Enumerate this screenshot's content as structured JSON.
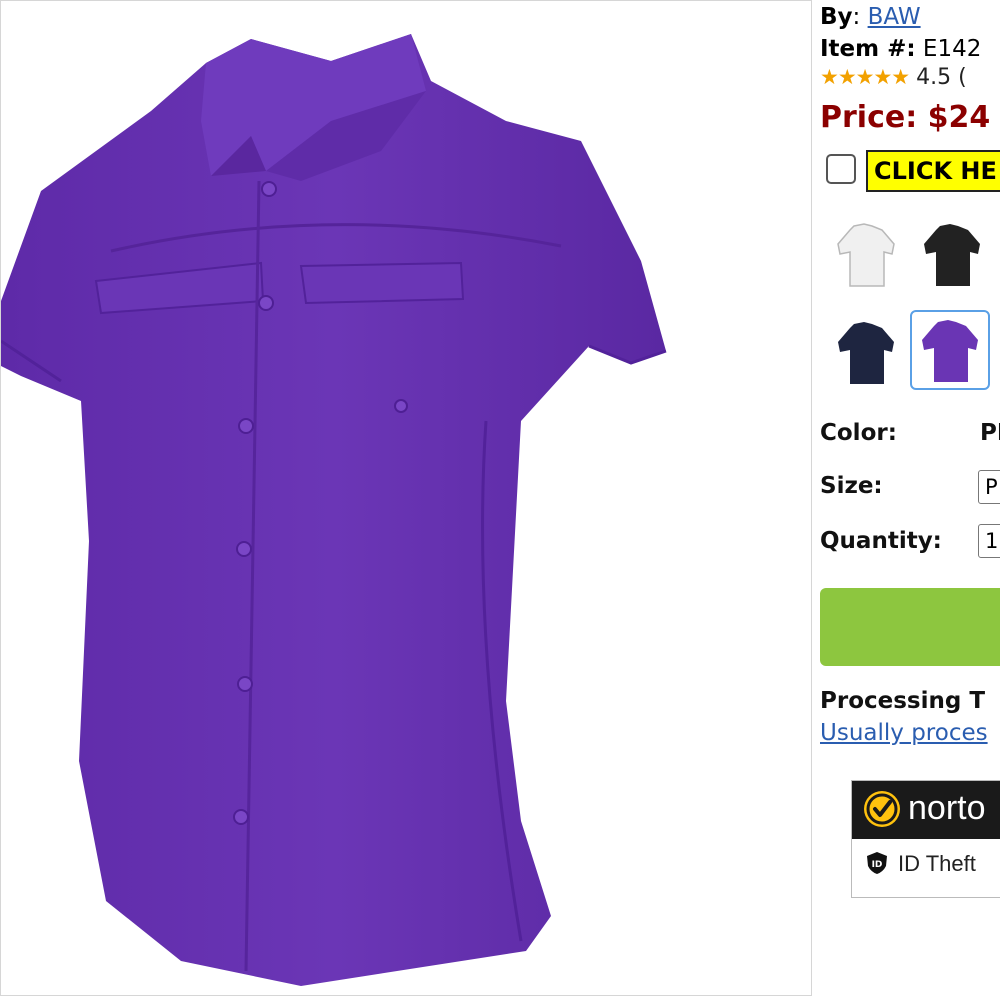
{
  "product": {
    "by_label": "By",
    "brand": "BAW",
    "item_label": "Item #:",
    "item_number": "E142",
    "stars": "★★★★★",
    "rating": "4.5 (",
    "price_label": "Price: $24",
    "click_label": "CLICK HE",
    "main_color_hex": "#6a35b4"
  },
  "swatches": [
    {
      "name": "white",
      "color": "#f2f2f2",
      "selected": false
    },
    {
      "name": "black",
      "color": "#222222",
      "selected": false
    },
    {
      "name": "navy",
      "color": "#1e2540",
      "selected": false
    },
    {
      "name": "purple",
      "color": "#6a35b4",
      "selected": true
    }
  ],
  "form": {
    "color_label": "Color:",
    "color_value": "PL",
    "size_label": "Size:",
    "size_value": "P",
    "quantity_label": "Quantity:",
    "quantity_value": "1"
  },
  "add_to_cart": {
    "color": "#8dc63f"
  },
  "processing": {
    "title": "Processing T",
    "link": "Usually proces"
  },
  "norton": {
    "name": "norto",
    "subtitle": "ID Theft"
  }
}
